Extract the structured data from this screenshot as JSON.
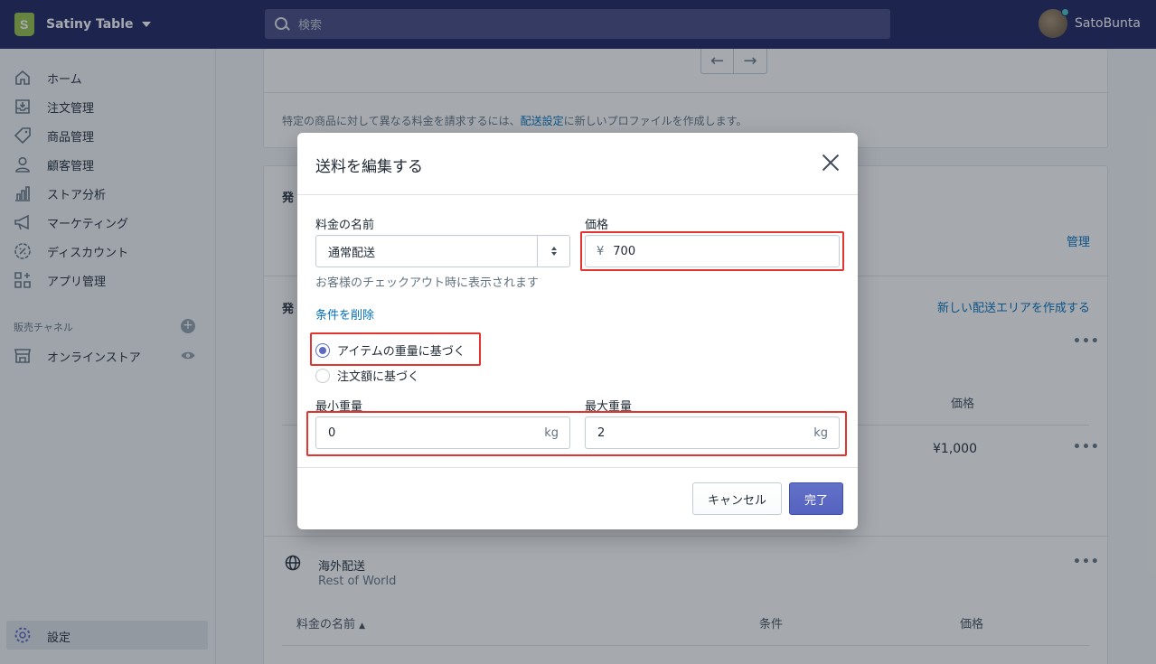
{
  "topbar": {
    "store_name": "Satiny Table",
    "search_placeholder": "検索",
    "user_name": "SatoBunta"
  },
  "sidebar": {
    "items": [
      {
        "label": "ホーム",
        "icon": "home-icon"
      },
      {
        "label": "注文管理",
        "icon": "orders-icon"
      },
      {
        "label": "商品管理",
        "icon": "tag-icon"
      },
      {
        "label": "顧客管理",
        "icon": "customer-icon"
      },
      {
        "label": "ストア分析",
        "icon": "analytics-icon"
      },
      {
        "label": "マーケティング",
        "icon": "megaphone-icon"
      },
      {
        "label": "ディスカウント",
        "icon": "discount-icon"
      },
      {
        "label": "アプリ管理",
        "icon": "apps-icon"
      }
    ],
    "sales_channel_label": "販売チャネル",
    "online_store_label": "オンラインストア",
    "settings_label": "設定"
  },
  "main": {
    "profile_note_prefix": "特定の商品に対して異なる料金を請求するには、",
    "profile_note_link": "配送設定",
    "profile_note_suffix": "に新しいプロファイルを作成します。",
    "section1_title_partial": "発",
    "manage_link": "管理",
    "section2_title_partial": "発",
    "new_zone_link": "新しい配送エリアを作成する",
    "price_header": "価格",
    "price_value": "¥1,000",
    "intl_title": "海外配送",
    "intl_subtitle": "Rest of World",
    "col_name": "料金の名前",
    "col_condition": "条件",
    "col_price": "価格"
  },
  "modal": {
    "title": "送料を編集する",
    "rate_name_label": "料金の名前",
    "rate_name_value": "通常配送",
    "rate_name_help": "お客様のチェックアウト時に表示されます",
    "price_label": "価格",
    "price_currency": "¥",
    "price_value": "700",
    "remove_conditions_link": "条件を削除",
    "radio_weight": "アイテムの重量に基づく",
    "radio_amount": "注文額に基づく",
    "min_weight_label": "最小重量",
    "min_weight_value": "0",
    "max_weight_label": "最大重量",
    "max_weight_value": "2",
    "weight_unit": "kg",
    "cancel_label": "キャンセル",
    "done_label": "完了"
  },
  "colors": {
    "topbar": "#1c2260",
    "primary_button": "#5c6ac4",
    "link": "#006fbb",
    "highlight": "#e3342f"
  }
}
